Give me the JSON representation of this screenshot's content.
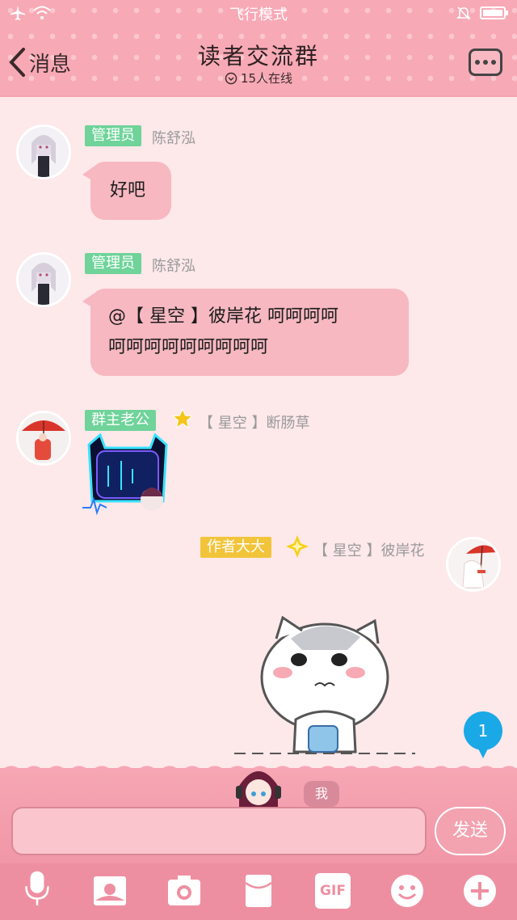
{
  "status_bar": {
    "mode": "飞行模式",
    "icons": [
      "airplane-icon",
      "wifi-icon",
      "bell-off-icon",
      "battery-icon"
    ]
  },
  "header": {
    "back_label": "消息",
    "title": "读者交流群",
    "online": "15人在线"
  },
  "messages": [
    {
      "badge": "管理员",
      "name": "陈舒泓",
      "text": "好吧"
    },
    {
      "badge": "管理员",
      "name": "陈舒泓",
      "text_line1": "@【 星空 】彼岸花 呵呵呵呵",
      "text_line2": "呵呵呵呵呵呵呵呵呵"
    },
    {
      "badge": "群主老公",
      "name": "【 星空 】断肠草"
    },
    {
      "badge": "作者大大",
      "name": "【 星空 】彼岸花"
    }
  ],
  "unread_count": "1",
  "me_tag": "我",
  "input": {
    "value": ""
  },
  "send_label": "发送",
  "toolbar": {
    "gif_label": "GIF"
  },
  "colors": {
    "header": "#f8a9b6",
    "bubble": "#f7b8c1",
    "admin_badge": "#6fd39a",
    "author_badge": "#f2c43a",
    "unread": "#1ba8e6"
  }
}
